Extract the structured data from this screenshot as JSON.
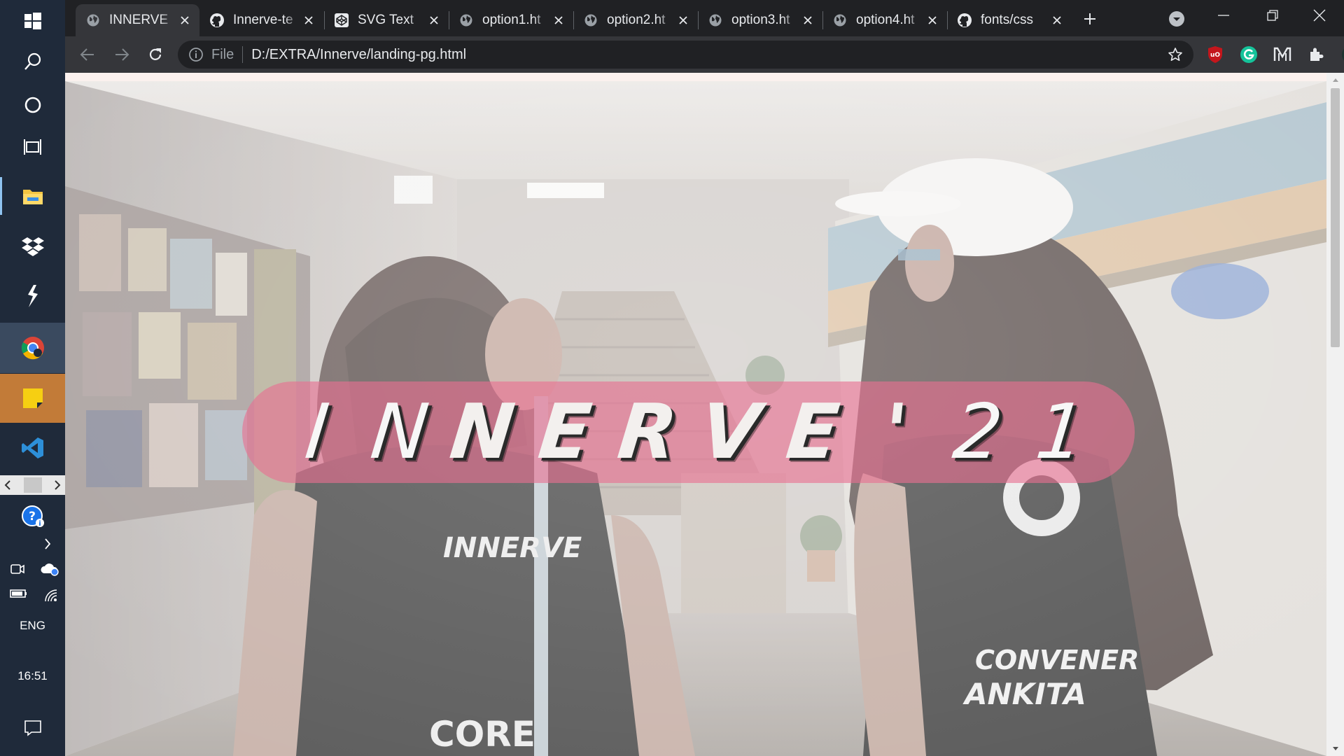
{
  "taskbar": {
    "language": "ENG",
    "clock": "16:51",
    "items": [
      {
        "icon": "windows-start-icon"
      },
      {
        "icon": "search-icon"
      },
      {
        "icon": "cortana-icon"
      },
      {
        "icon": "task-view-icon"
      },
      {
        "icon": "file-explorer-icon"
      },
      {
        "icon": "dropbox-icon"
      },
      {
        "icon": "app-icon"
      },
      {
        "icon": "chrome-icon"
      },
      {
        "icon": "sticky-notes-icon"
      },
      {
        "icon": "vscode-icon"
      }
    ],
    "accent_explorer": "#f4c542",
    "accent_sticky": "#f6cf12",
    "accent_vscode": "#2d8fd8"
  },
  "browser": {
    "tabs": [
      {
        "title": "INNERVE",
        "favicon": "globe-icon",
        "active": true
      },
      {
        "title": "Innerve-te",
        "favicon": "github-icon"
      },
      {
        "title": "SVG Text",
        "favicon": "codepen-icon"
      },
      {
        "title": "option1.ht",
        "favicon": "globe-icon"
      },
      {
        "title": "option2.ht",
        "favicon": "globe-icon"
      },
      {
        "title": "option3.ht",
        "favicon": "globe-icon"
      },
      {
        "title": "option4.ht",
        "favicon": "globe-icon"
      },
      {
        "title": "fonts/css",
        "favicon": "github-icon"
      }
    ],
    "address": {
      "scheme_label": "File",
      "url": "D:/EXTRA/Innerve/landing-pg.html"
    },
    "extensions": [
      {
        "icon": "ublock-icon",
        "color": "#c4161c"
      },
      {
        "icon": "grammarly-icon",
        "color": "#15c39a"
      },
      {
        "icon": "m-extension-icon"
      },
      {
        "icon": "extensions-puzzle-icon"
      },
      {
        "icon": "profile-avatar-icon"
      },
      {
        "icon": "menu-kebab-icon"
      }
    ]
  },
  "page": {
    "title_letters": [
      "I",
      "N",
      "N",
      "E",
      "R",
      "V",
      "E",
      "'",
      "2",
      "1"
    ],
    "banner_color": "#e97092"
  }
}
